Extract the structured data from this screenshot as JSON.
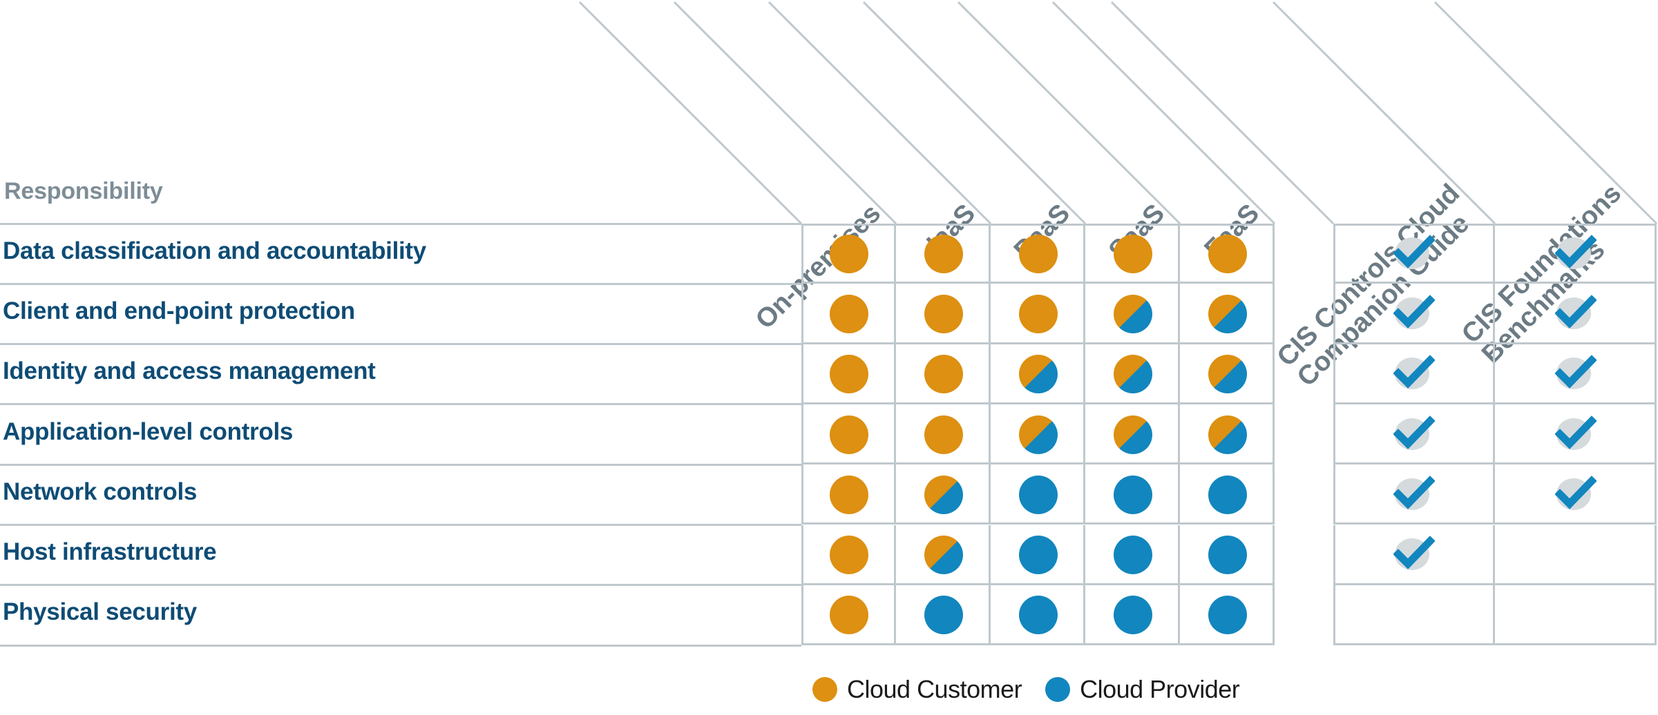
{
  "header": {
    "responsibility_label": "Responsibility"
  },
  "columns": [
    {
      "id": "on-premises",
      "label": "On-premises",
      "group": "service-model"
    },
    {
      "id": "iaas",
      "label": "IaaS",
      "group": "service-model"
    },
    {
      "id": "paas",
      "label": "PaaS",
      "group": "service-model"
    },
    {
      "id": "saas",
      "label": "SaaS",
      "group": "service-model"
    },
    {
      "id": "faas",
      "label": "FaaS",
      "group": "service-model"
    },
    {
      "id": "cis-controls-cloud-companion-guide",
      "label": "CIS Controls Cloud Companion Guide",
      "label_line1": "CIS Controls Cloud",
      "label_line2": "Companion Guide",
      "group": "cis-resource"
    },
    {
      "id": "cis-foundations-benchmarks",
      "label": "CIS Foundations Benchmarks",
      "label_line1": "CIS Foundations",
      "label_line2": "Benchmarks",
      "group": "cis-resource"
    }
  ],
  "rows": [
    {
      "label": "Data classification and accountability",
      "responsibility": [
        "customer",
        "customer",
        "customer",
        "customer",
        "customer"
      ],
      "cis_controls_cloud_companion_guide": true,
      "cis_foundations_benchmarks": true
    },
    {
      "label": "Client and end-point protection",
      "responsibility": [
        "customer",
        "customer",
        "customer",
        "shared",
        "shared"
      ],
      "cis_controls_cloud_companion_guide": true,
      "cis_foundations_benchmarks": true
    },
    {
      "label": "Identity and access management",
      "responsibility": [
        "customer",
        "customer",
        "shared",
        "shared",
        "shared"
      ],
      "cis_controls_cloud_companion_guide": true,
      "cis_foundations_benchmarks": true
    },
    {
      "label": "Application-level controls",
      "responsibility": [
        "customer",
        "customer",
        "shared",
        "shared",
        "shared"
      ],
      "cis_controls_cloud_companion_guide": true,
      "cis_foundations_benchmarks": true
    },
    {
      "label": "Network controls",
      "responsibility": [
        "customer",
        "shared",
        "provider",
        "provider",
        "provider"
      ],
      "cis_controls_cloud_companion_guide": true,
      "cis_foundations_benchmarks": true
    },
    {
      "label": "Host infrastructure",
      "responsibility": [
        "customer",
        "shared",
        "provider",
        "provider",
        "provider"
      ],
      "cis_controls_cloud_companion_guide": true,
      "cis_foundations_benchmarks": false
    },
    {
      "label": "Physical security",
      "responsibility": [
        "customer",
        "provider",
        "provider",
        "provider",
        "provider"
      ],
      "cis_controls_cloud_companion_guide": false,
      "cis_foundations_benchmarks": false
    }
  ],
  "legend": [
    {
      "id": "cloud-customer",
      "label": "Cloud Customer",
      "color": "#DD9011"
    },
    {
      "id": "cloud-provider",
      "label": "Cloud Provider",
      "color": "#1286BE"
    }
  ],
  "colors": {
    "customer": "#DD9011",
    "provider": "#1286BE",
    "grid_line": "#BFC8CD",
    "header_text": "#6C7B84",
    "row_label_text": "#0E4C75",
    "check_disc": "#D5DADD",
    "check_mark": "#1286BE"
  },
  "icons": {
    "check": "check-icon"
  }
}
